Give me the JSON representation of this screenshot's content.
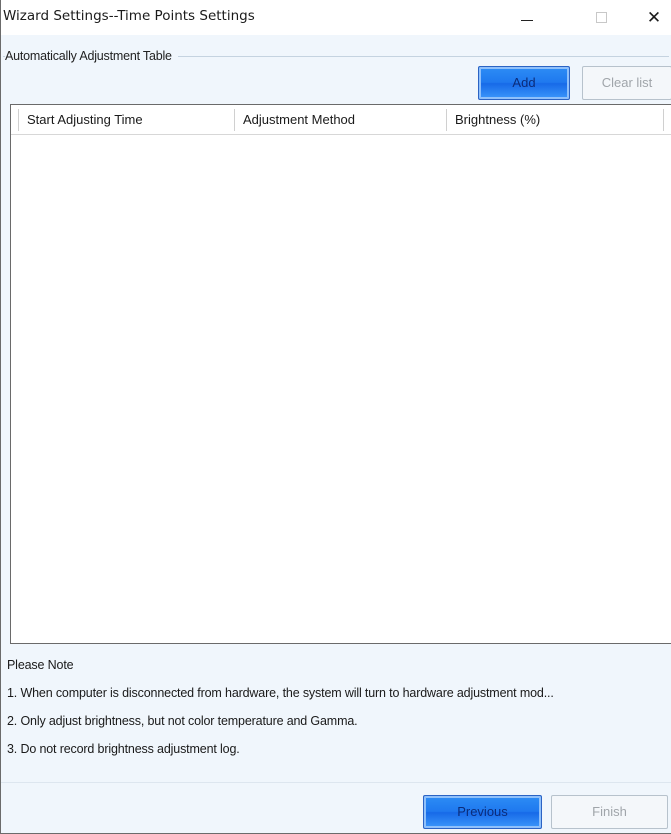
{
  "window": {
    "title": "Wizard Settings--Time Points Settings",
    "close_glyph": "✕"
  },
  "group": {
    "label": "Automatically Adjustment Table"
  },
  "toolbar": {
    "add_label": "Add",
    "clear_label": "Clear list"
  },
  "table": {
    "columns": [
      "Start Adjusting Time",
      "Adjustment Method",
      "Brightness (%)"
    ],
    "rows": []
  },
  "notes": {
    "title": "Please Note",
    "items": [
      "1. When computer is disconnected from hardware, the system will turn to hardware adjustment mod...",
      "2. Only adjust brightness, but not color temperature and Gamma.",
      "3. Do not record brightness adjustment log."
    ]
  },
  "footer": {
    "previous_label": "Previous",
    "finish_label": "Finish"
  },
  "colors": {
    "accent": "#1f79ef",
    "panel_background": "#f0f6fc",
    "disabled_text": "#a0a5aa"
  }
}
